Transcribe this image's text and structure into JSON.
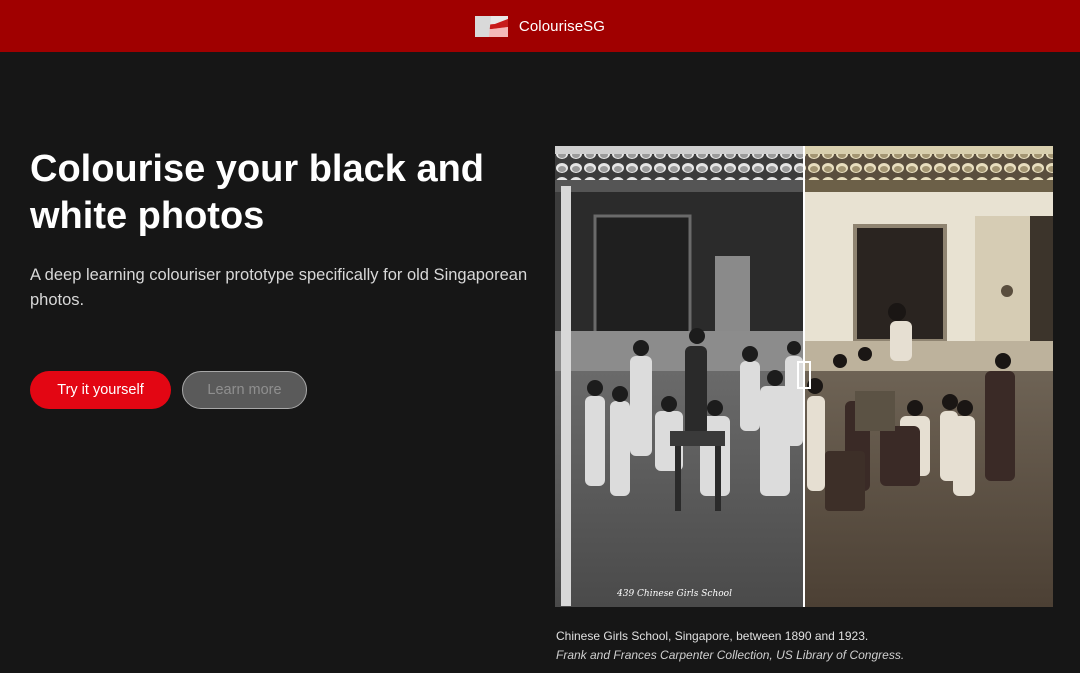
{
  "header": {
    "brand_name": "ColouriseSG",
    "logo_icon": "colourise-flag-logo-icon",
    "color": "#a00000"
  },
  "hero": {
    "title": "Colourise your black and white photos",
    "subtitle": "A deep learning colouriser prototype specifically for old Singaporean photos.",
    "primary_button": "Try it yourself",
    "secondary_button": "Learn more",
    "accent_color": "#e30613"
  },
  "comparison": {
    "left_label": "black-and-white original",
    "right_label": "colourised result",
    "divider_position_percent": 50,
    "handle_icon": "slider-handle-icon",
    "photo_inscription": "439 Chinese Girls School",
    "caption": "Chinese Girls School, Singapore, between 1890 and 1923.",
    "credit": "Frank and Frances Carpenter Collection, US Library of Congress."
  }
}
